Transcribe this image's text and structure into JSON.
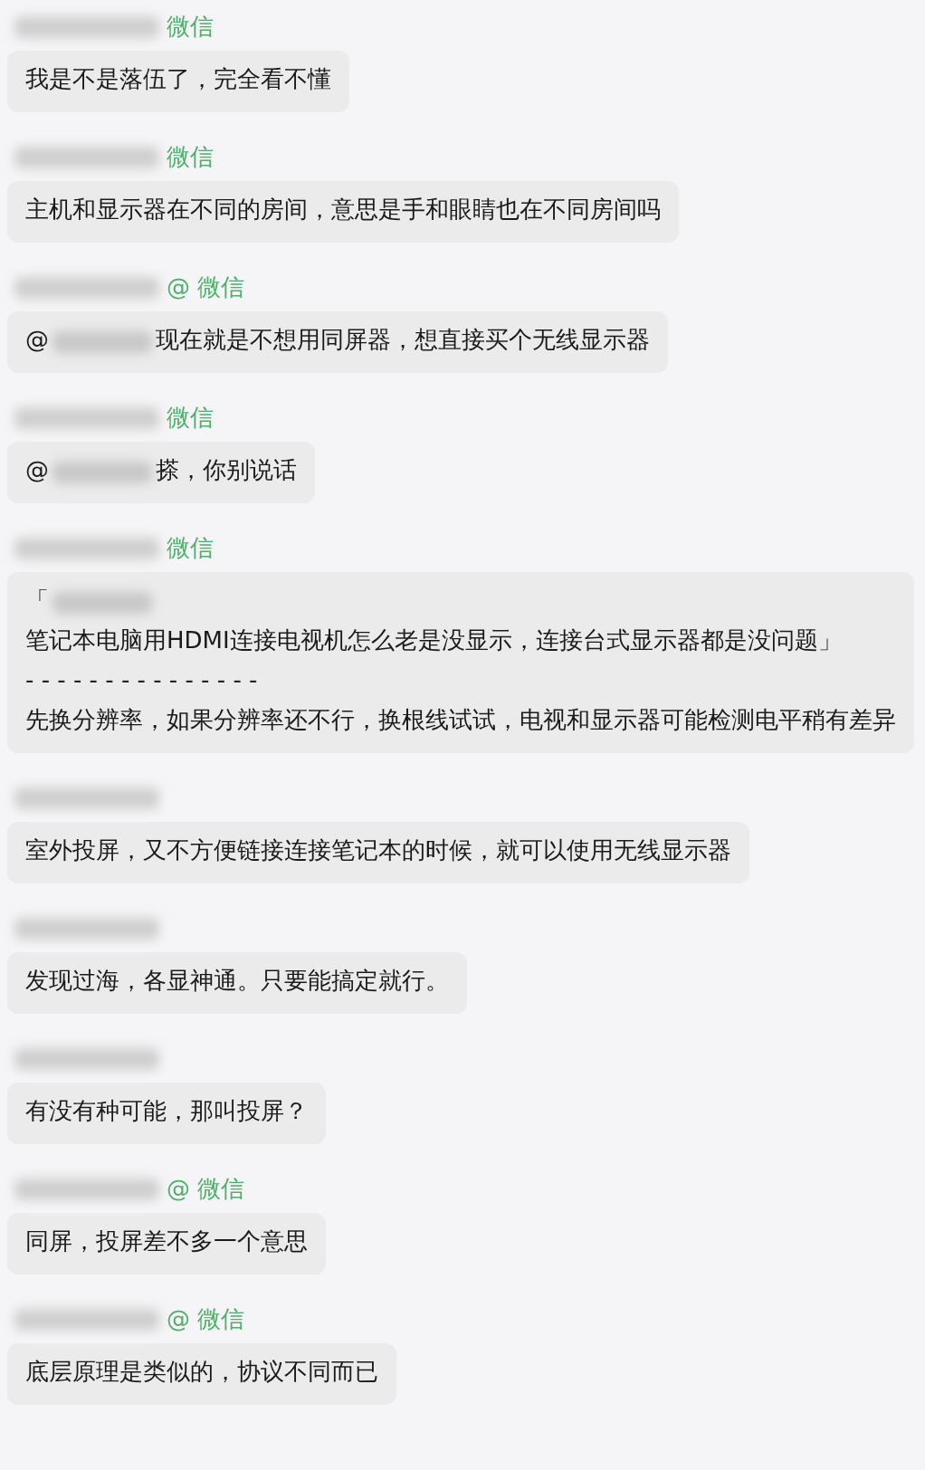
{
  "messages": [
    {
      "sender": {
        "suffix": "微信"
      },
      "lines": [
        [
          {
            "kind": "text",
            "text": "我是不是落伍了，完全看不懂"
          }
        ]
      ]
    },
    {
      "sender": {
        "suffix": "微信"
      },
      "lines": [
        [
          {
            "kind": "text",
            "text": "主机和显示器在不同的房间，意思是手和眼睛也在不同房间吗"
          }
        ]
      ]
    },
    {
      "sender": {
        "suffix": "@ 微信"
      },
      "lines": [
        [
          {
            "kind": "text",
            "text": "@"
          },
          {
            "kind": "blur"
          },
          {
            "kind": "text",
            "text": "现在就是不想用同屏器，想直接买个无线显示器"
          }
        ]
      ]
    },
    {
      "sender": {
        "suffix": "微信"
      },
      "lines": [
        [
          {
            "kind": "text",
            "text": "@"
          },
          {
            "kind": "blur"
          },
          {
            "kind": "text",
            "text": "搽，你别说话"
          }
        ]
      ]
    },
    {
      "sender": {
        "suffix": "微信"
      },
      "lines": [
        [
          {
            "kind": "text",
            "text": "「"
          },
          {
            "kind": "blur"
          }
        ],
        [
          {
            "kind": "text",
            "text": "笔记本电脑用HDMI连接电视机怎么老是没显示，连接台式显示器都是没问题」"
          }
        ],
        [
          {
            "kind": "text",
            "text": "- - - - - - - - - - - - - - -"
          }
        ],
        [
          {
            "kind": "text",
            "text": "先换分辨率，如果分辨率还不行，换根线试试，电视和显示器可能检测电平稍有差异"
          }
        ]
      ]
    },
    {
      "lines": [
        [
          {
            "kind": "text",
            "text": "室外投屏，又不方便链接连接笔记本的时候，就可以使用无线显示器"
          }
        ]
      ]
    },
    {
      "lines": [
        [
          {
            "kind": "text",
            "text": "发现过海，各显神通。只要能搞定就行。"
          }
        ]
      ]
    },
    {
      "lines": [
        [
          {
            "kind": "text",
            "text": "有没有种可能，那叫投屏？"
          }
        ]
      ]
    },
    {
      "sender": {
        "suffix": "@ 微信"
      },
      "lines": [
        [
          {
            "kind": "text",
            "text": "同屏，投屏差不多一个意思"
          }
        ]
      ]
    },
    {
      "sender": {
        "suffix": "@ 微信"
      },
      "lines": [
        [
          {
            "kind": "text",
            "text": "底层原理是类似的，协议不同而已"
          }
        ]
      ]
    }
  ]
}
